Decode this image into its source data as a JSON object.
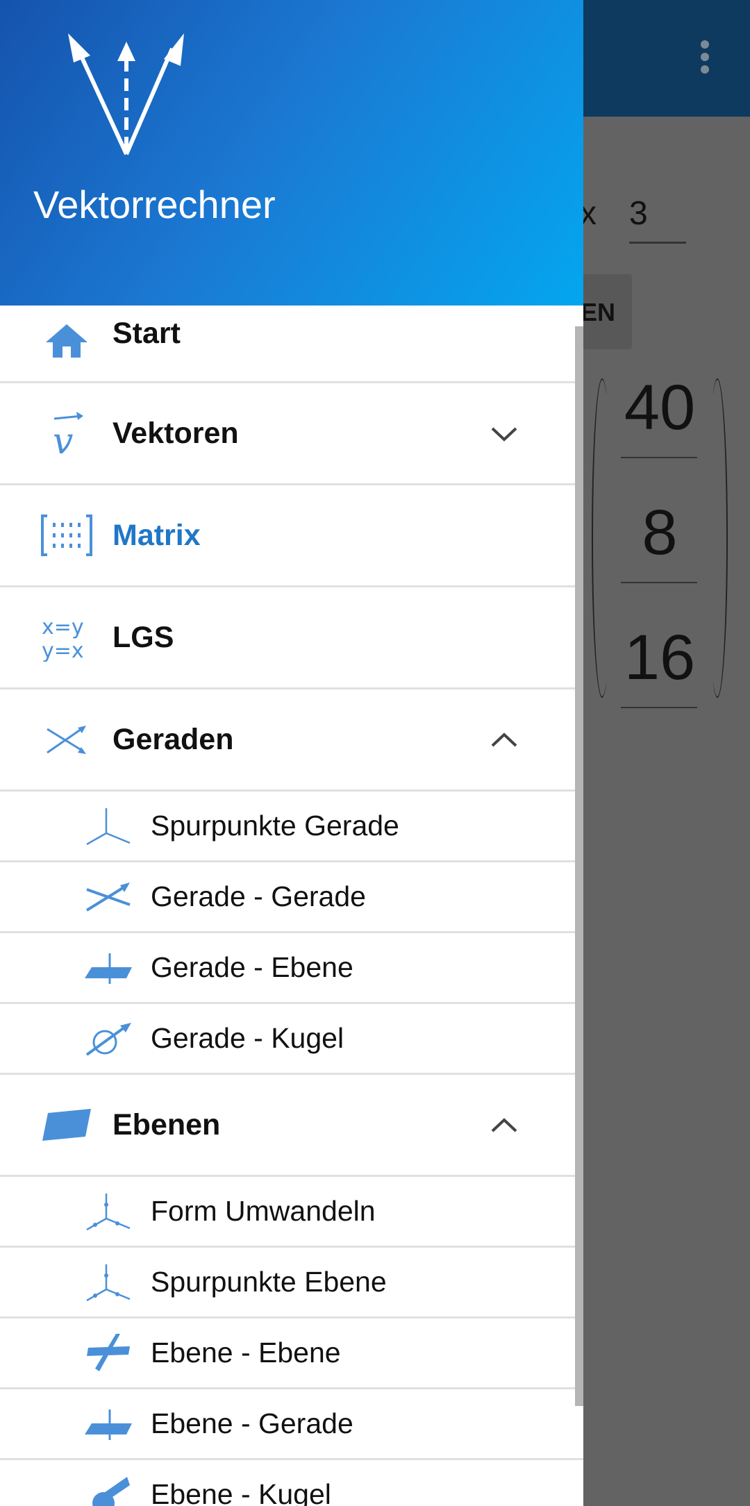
{
  "app_title": "Vektorrechner",
  "background": {
    "dim_sep": "x",
    "dim_value": "3",
    "button_label": "EN",
    "matrix_values": [
      "40",
      "8",
      "16"
    ]
  },
  "menu": {
    "start": "Start",
    "vektoren": "Vektoren",
    "matrix": "Matrix",
    "lgs": "LGS",
    "geraden": "Geraden",
    "geraden_items": [
      "Spurpunkte Gerade",
      "Gerade - Gerade",
      "Gerade - Ebene",
      "Gerade - Kugel"
    ],
    "ebenen": "Ebenen",
    "ebenen_items": [
      "Form Umwandeln",
      "Spurpunkte Ebene",
      "Ebene - Ebene",
      "Ebene - Gerade",
      "Ebene - Kugel"
    ]
  },
  "colors": {
    "accent": "#4a90d9",
    "active": "#1f77c8",
    "header_start": "#1553ad",
    "header_end": "#04a6ef"
  }
}
